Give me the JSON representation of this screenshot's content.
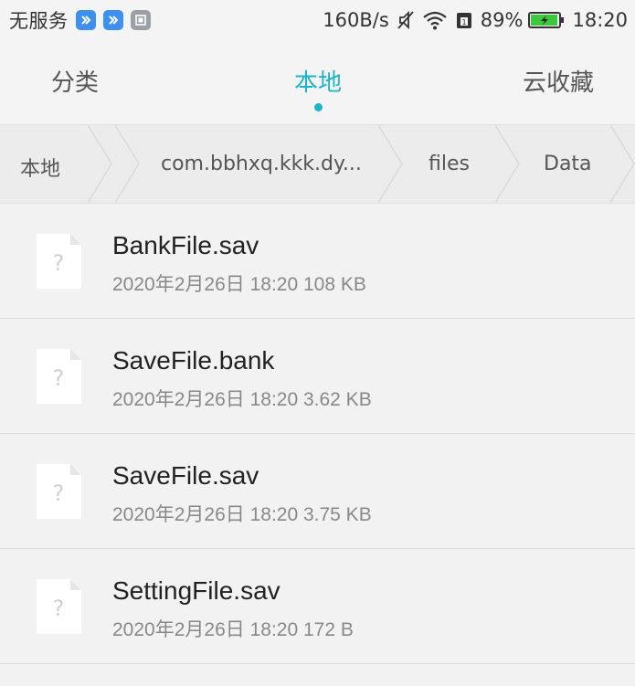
{
  "status_bar": {
    "carrier": "无服务",
    "network_speed": "160B/s",
    "battery_percent": "89%",
    "time": "18:20",
    "icons": [
      "notification-app-icon",
      "notification-app-icon",
      "notification-image-icon",
      "mute-icon",
      "wifi-icon",
      "sim-icon",
      "battery-charging-icon"
    ]
  },
  "tabs": [
    {
      "label": "分类",
      "active": false
    },
    {
      "label": "本地",
      "active": true
    },
    {
      "label": "云收藏",
      "active": false
    }
  ],
  "breadcrumb": [
    "本地",
    "com.bbhxq.kkk.dy...",
    "files",
    "Data"
  ],
  "files": [
    {
      "name": "BankFile.sav",
      "meta": "2020年2月26日 18:20 108 KB",
      "icon": "unknown-file-icon"
    },
    {
      "name": "SaveFile.bank",
      "meta": "2020年2月26日 18:20 3.62 KB",
      "icon": "unknown-file-icon"
    },
    {
      "name": "SaveFile.sav",
      "meta": "2020年2月26日 18:20 3.75 KB",
      "icon": "unknown-file-icon"
    },
    {
      "name": "SettingFile.sav",
      "meta": "2020年2月26日 18:20 172 B",
      "icon": "unknown-file-icon"
    }
  ],
  "colors": {
    "accent": "#1fb3c7",
    "background": "#f2f2f2",
    "battery": "#3cc83c"
  }
}
